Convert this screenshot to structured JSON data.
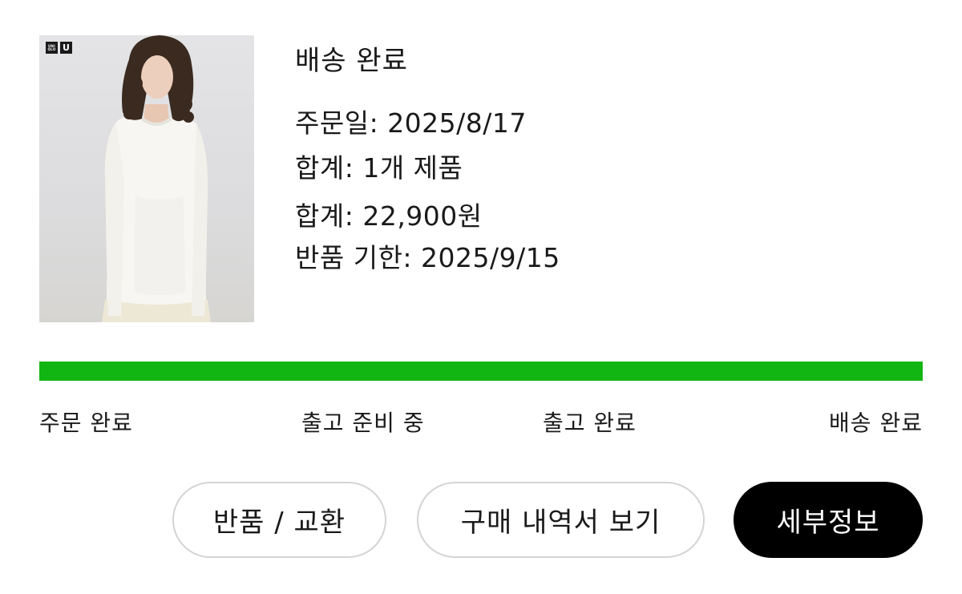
{
  "product": {
    "brand_logo_text": "UNI QLO",
    "brand_logo_u": "U",
    "image_description": "white long-sleeve t-shirt"
  },
  "order": {
    "status": "배송 완료",
    "order_date": "주문일: 2025/8/17",
    "item_count": "합계: 1개 제품",
    "total_price": "합계: 22,900원",
    "return_deadline": "반품 기한: 2025/9/15"
  },
  "progress": {
    "fill_fraction": 1.0,
    "color": "#12b612",
    "steps": [
      {
        "label": "주문 완료"
      },
      {
        "label": "출고 준비 중"
      },
      {
        "label": "출고 완료"
      },
      {
        "label": "배송 완료"
      }
    ]
  },
  "actions": {
    "return_exchange_label": "반품 / 교환",
    "view_receipt_label": "구매 내역서 보기",
    "details_label": "세부정보"
  }
}
